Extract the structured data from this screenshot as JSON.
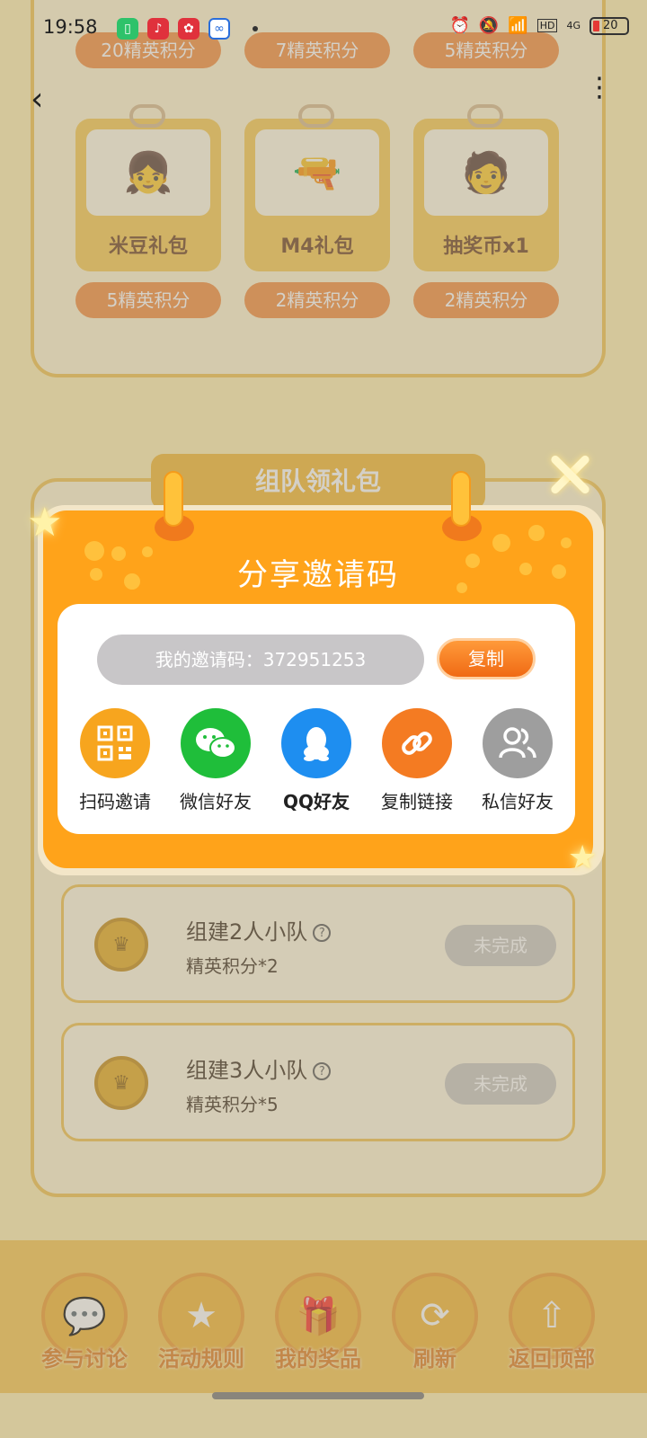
{
  "status_bar": {
    "time": "19:58",
    "hd_label": "HD",
    "network_label": "4G",
    "battery": "20"
  },
  "rewards": {
    "top_costs": [
      "20精英积分",
      "7精英积分",
      "5精英积分"
    ],
    "items": [
      {
        "name": "米豆礼包",
        "cost": "5精英积分"
      },
      {
        "name": "M4礼包",
        "cost": "2精英积分"
      },
      {
        "name": "抽奖币x1",
        "cost": "2精英积分"
      }
    ]
  },
  "team_section": {
    "title": "组队领礼包",
    "tasks": [
      {
        "title": "组建2人小队",
        "reward": "精英积分*2",
        "status": "未完成"
      },
      {
        "title": "组建3人小队",
        "reward": "精英积分*5",
        "status": "未完成"
      }
    ]
  },
  "modal": {
    "title": "分享邀请码",
    "code_text": "我的邀请码：372951253",
    "copy_label": "复制",
    "share_options": [
      {
        "label": "扫码邀请",
        "icon": "qr-code-icon",
        "color": "#f7a51e"
      },
      {
        "label": "微信好友",
        "icon": "wechat-icon",
        "color": "#1fbe3a"
      },
      {
        "label": "QQ好友",
        "icon": "qq-icon",
        "color": "#1e8ef0"
      },
      {
        "label": "复制链接",
        "icon": "link-icon",
        "color": "#f47b22"
      },
      {
        "label": "私信好友",
        "icon": "friends-icon",
        "color": "#9e9e9e"
      }
    ]
  },
  "bottom_nav": [
    {
      "label": "参与讨论"
    },
    {
      "label": "活动规则"
    },
    {
      "label": "我的奖品"
    },
    {
      "label": "刷新"
    },
    {
      "label": "返回顶部"
    }
  ]
}
